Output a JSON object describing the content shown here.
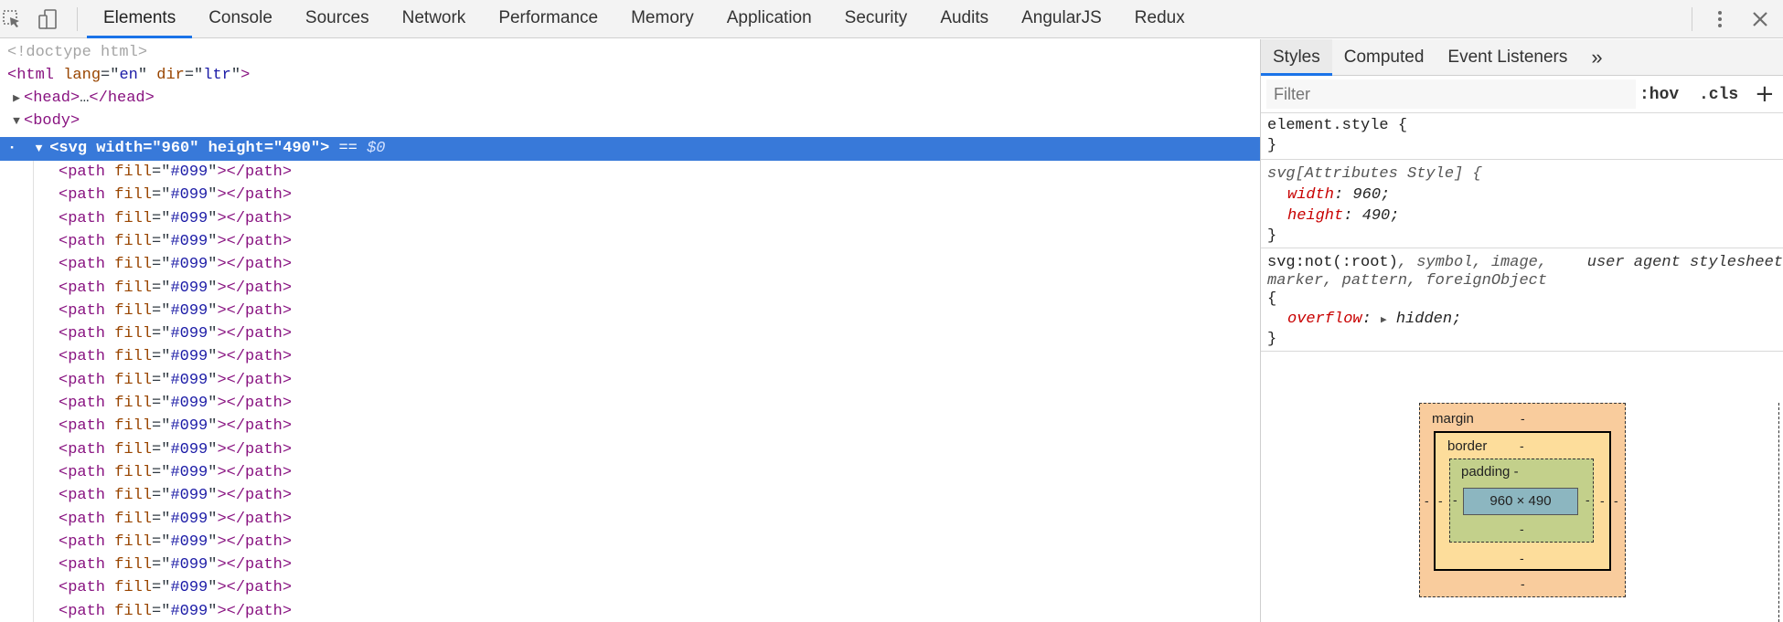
{
  "toolbar": {
    "tabs": [
      "Elements",
      "Console",
      "Sources",
      "Network",
      "Performance",
      "Memory",
      "Application",
      "Security",
      "Audits",
      "AngularJS",
      "Redux"
    ],
    "icons": [
      "inspect-element-icon",
      "device-toggle-icon",
      "more-vert-icon",
      "close-icon"
    ]
  },
  "dom": {
    "doctype": "<!doctype html>",
    "html_open": {
      "tag": "<html",
      "attr1": "lang",
      "val1": "en",
      "attr2": "dir",
      "val2": "ltr",
      "end": ">"
    },
    "head": {
      "open": "<head>",
      "ellipsis": "…",
      "close": "</head>"
    },
    "body": "<body>",
    "svg_selected": "<svg width=\"960\" height=\"490\">",
    "svg_suffix": " == ",
    "dollar": "$0",
    "path": {
      "open": "<path",
      "attr": "fill",
      "val": "#099",
      "close": "></path>"
    },
    "path_count": 20
  },
  "styles": {
    "tabs": [
      "Styles",
      "Computed",
      "Event Listeners",
      "»"
    ],
    "filter_placeholder": "Filter",
    "hov": ":hov",
    "cls": ".cls",
    "plus": "+",
    "rule1": {
      "selector": "element.style {",
      "close": "}"
    },
    "rule2": {
      "selector": "svg[Attributes Style] {",
      "prop1": "width",
      "val1": " 960;",
      "prop2": "height",
      "val2": " 490;",
      "close": "}"
    },
    "rule3": {
      "selector_main": "svg:not(:root)",
      "selector_rest": ", symbol, image,",
      "selector_line2": "marker, pattern, foreignObject",
      "origin": "user agent stylesheet",
      "open": "{",
      "prop": "overflow",
      "val": " hidden;",
      "close": "}"
    }
  },
  "box_model": {
    "margin_label": "margin",
    "border_label": "border",
    "padding_label": "padding",
    "dash": "-",
    "content": "960 × 490"
  },
  "colors": {
    "selection": "#3879d9",
    "margin": "#f9cc9d",
    "border": "#fddd9b",
    "padding": "#c3d08b",
    "content": "#8cb6c0"
  }
}
